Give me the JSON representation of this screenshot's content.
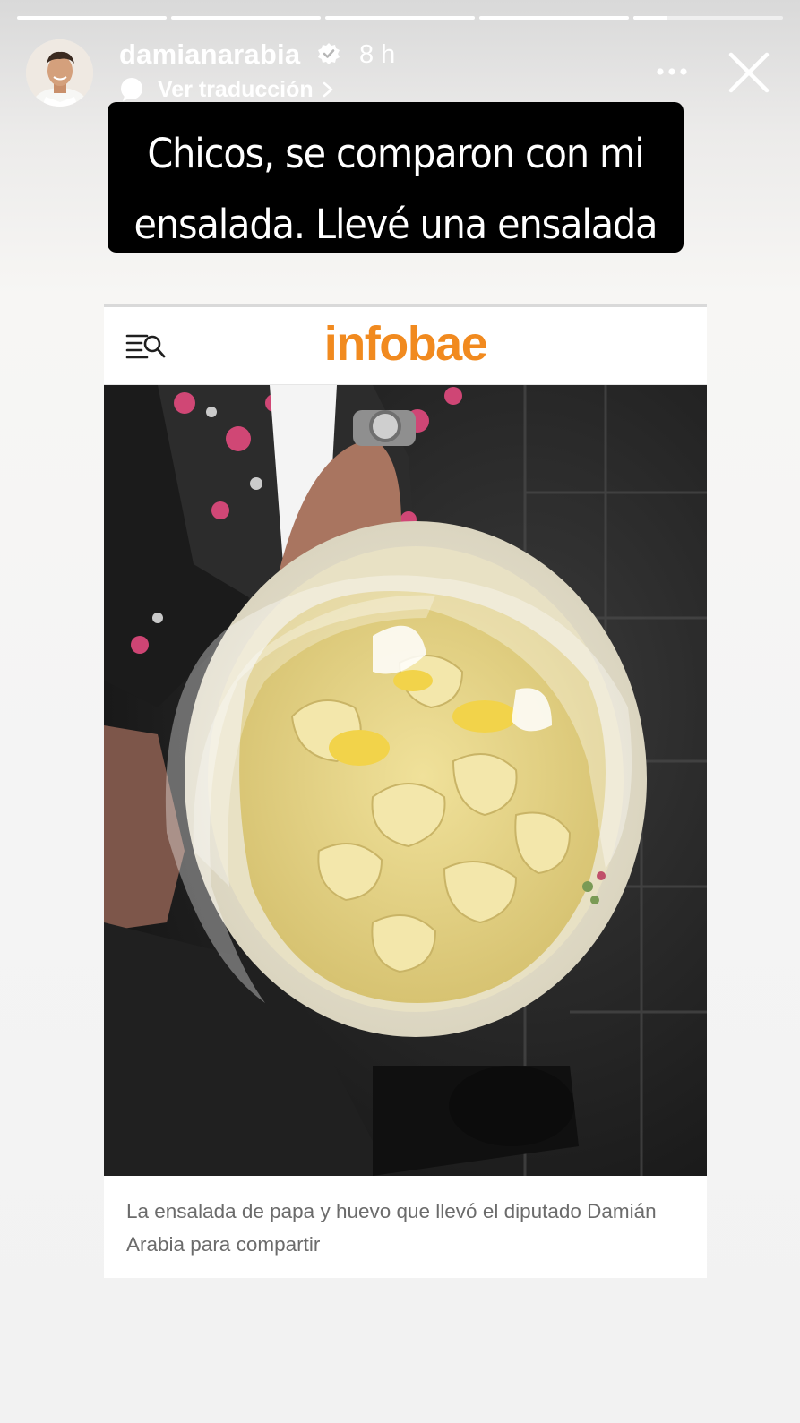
{
  "story": {
    "progress_segments": [
      1,
      1,
      1,
      1,
      0.22
    ],
    "active_segment_index": 4
  },
  "header": {
    "username": "damianarabia",
    "verified_icon": "verified-badge-icon",
    "time": "8 h",
    "translate_label": "Ver traducción",
    "more_icon": "more-horizontal-icon",
    "close_icon": "close-icon"
  },
  "text_overlay": {
    "text": "Chicos, se comparon con mi\nensalada. Llevé una ensalada"
  },
  "article": {
    "logo": "infobae",
    "menu_icon": "menu-search-icon",
    "brand_color": "#f18a1f",
    "photo_alt": "potato-egg-salad-photo",
    "caption": "La ensalada de papa y huevo que llevó el diputado Damián Arabia para compartir"
  }
}
